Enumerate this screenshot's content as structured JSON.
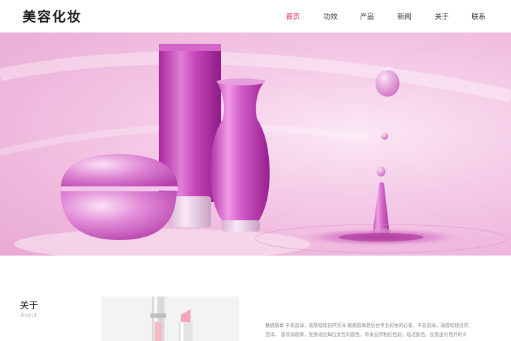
{
  "header": {
    "logo": "美容化妆",
    "nav": [
      {
        "label": "首页",
        "active": true
      },
      {
        "label": "功效",
        "active": false
      },
      {
        "label": "产品",
        "active": false
      },
      {
        "label": "新闻",
        "active": false
      },
      {
        "label": "关于",
        "active": false
      },
      {
        "label": "联系",
        "active": false
      }
    ]
  },
  "colors": {
    "accent": "#e6184a",
    "product_magenta": "#c43fb6",
    "hero_pink": "#f2c4e3"
  },
  "about": {
    "title": "关于",
    "subtitle": "About",
    "text_lines": [
      "魅惑唇膏 丰盈滋润，双唇绽现自然亮泽 魅惑唇膏是后台专业彩妆的必备，丰盈滋润，双唇绽现自然",
      "亮泽。 喜欢润唇膏，完美适应每位女性的唇色，带来自然粉红色彩，贴近肤色，绽现由内而外的丰"
    ]
  }
}
